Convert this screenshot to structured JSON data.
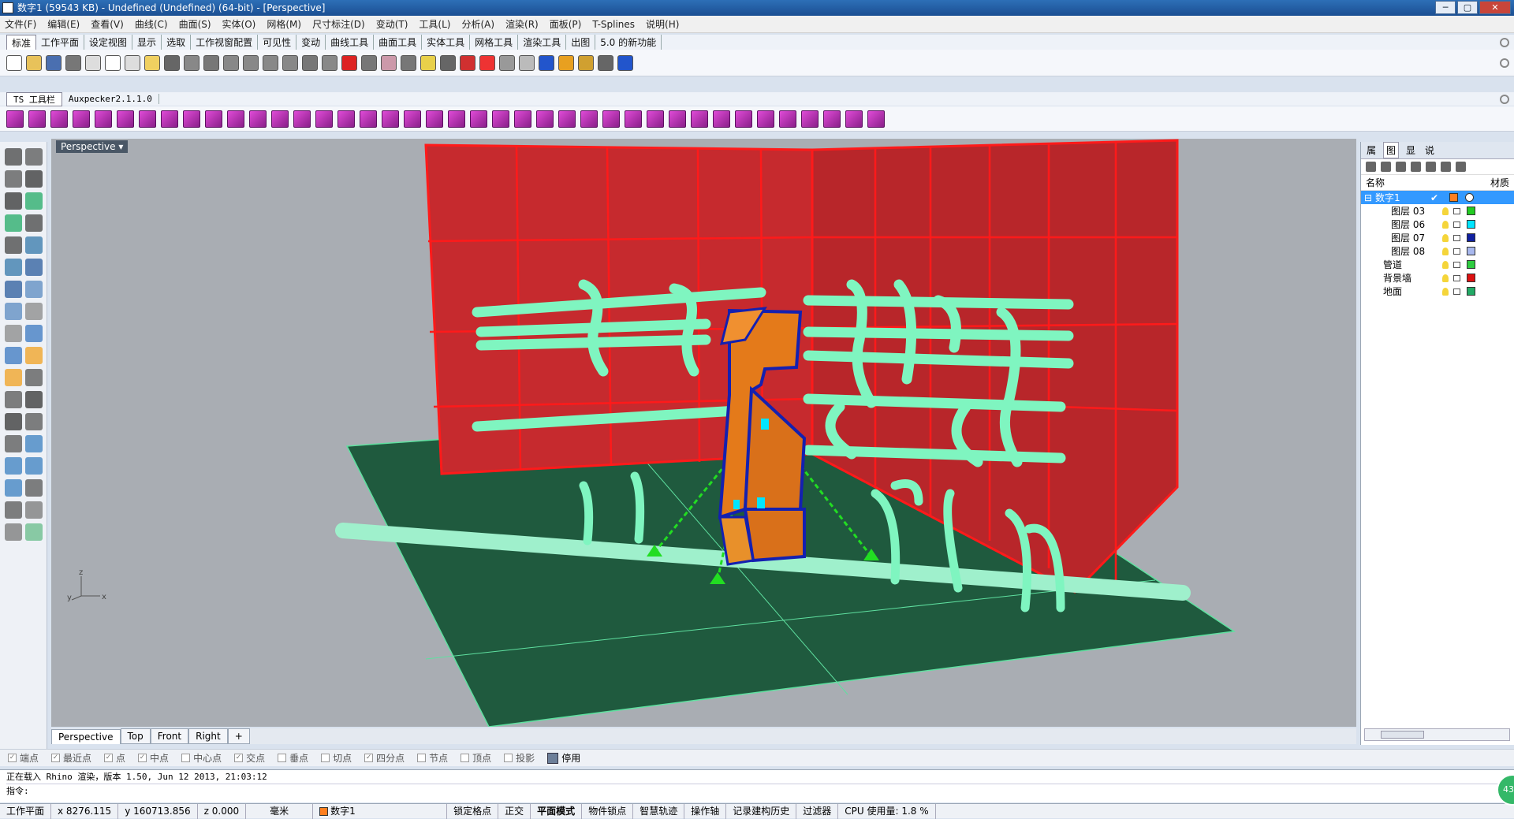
{
  "window": {
    "title": "数字1 (59543 KB) - Undefined (Undefined) (64-bit) - [Perspective]",
    "min": "─",
    "max": "▢",
    "close": "✕"
  },
  "menu": [
    "文件(F)",
    "编辑(E)",
    "查看(V)",
    "曲线(C)",
    "曲面(S)",
    "实体(O)",
    "网格(M)",
    "尺寸标注(D)",
    "变动(T)",
    "工具(L)",
    "分析(A)",
    "渲染(R)",
    "面板(P)",
    "T-Splines",
    "说明(H)"
  ],
  "tabs": [
    "标准",
    "工作平面",
    "设定视图",
    "显示",
    "选取",
    "工作视窗配置",
    "可见性",
    "变动",
    "曲线工具",
    "曲面工具",
    "实体工具",
    "网格工具",
    "渲染工具",
    "出图",
    "5.0 的新功能"
  ],
  "tabs2": [
    "TS 工具栏",
    "Auxpecker2.1.1.0"
  ],
  "viewport": {
    "label": "Perspective",
    "axis_z": "z",
    "axis_y": "y",
    "axis_x": "x"
  },
  "viewtabs": [
    "Perspective",
    "Top",
    "Front",
    "Right",
    "+"
  ],
  "panel": {
    "tabs": [
      "属",
      "图",
      "显",
      "说"
    ],
    "col_name": "名称",
    "col_material": "材质",
    "layers": [
      {
        "name": "数字1",
        "color": "#ff7f1f",
        "check": "✔",
        "selected": true,
        "indent": 0,
        "expander": "⊟"
      },
      {
        "name": "图层 03",
        "color": "#22cc22",
        "indent": 2
      },
      {
        "name": "图层 06",
        "color": "#00e5ff",
        "indent": 2
      },
      {
        "name": "图层 07",
        "color": "#1020a0",
        "indent": 2
      },
      {
        "name": "图层 08",
        "color": "#a8b8ee",
        "indent": 2
      },
      {
        "name": "管道",
        "color": "#2ecc40",
        "indent": 1
      },
      {
        "name": "背景墙",
        "color": "#dd1111",
        "indent": 1
      },
      {
        "name": "地面",
        "color": "#22aa66",
        "indent": 1
      }
    ]
  },
  "snaps": [
    {
      "label": "端点",
      "checked": true
    },
    {
      "label": "最近点",
      "checked": true
    },
    {
      "label": "点",
      "checked": true
    },
    {
      "label": "中点",
      "checked": true
    },
    {
      "label": "中心点",
      "checked": false
    },
    {
      "label": "交点",
      "checked": true
    },
    {
      "label": "垂点",
      "checked": false
    },
    {
      "label": "切点",
      "checked": false
    },
    {
      "label": "四分点",
      "checked": true
    },
    {
      "label": "节点",
      "checked": false
    },
    {
      "label": "顶点",
      "checked": false
    },
    {
      "label": "投影",
      "checked": false
    }
  ],
  "snap_stop": "停用",
  "command": {
    "history": "正在载入 Rhino 渲染，版本 1.50, Jun 12 2013, 21:03:12",
    "prompt": "指令:"
  },
  "status": {
    "cplane": "工作平面",
    "x": "x 8276.115",
    "y": "y 160713.856",
    "z": "z 0.000",
    "units": "毫米",
    "layer": "数字1",
    "grid_snap": "锁定格点",
    "ortho": "正交",
    "planar": "平面模式",
    "osnap": "物件锁点",
    "smarttrack": "智慧轨迹",
    "gumball": "操作轴",
    "history": "记录建构历史",
    "filter": "过滤器",
    "cpu": "CPU 使用量: 1.8 %"
  },
  "badge": "43",
  "colors": {
    "wall": "#c62a2e",
    "wall_edge": "#ff1a1a",
    "pipe": "#7ff5c0",
    "floor": "#1f5a3e",
    "object": "#e47a1a",
    "object_edge": "#1420b0",
    "support": "#22dd22"
  }
}
